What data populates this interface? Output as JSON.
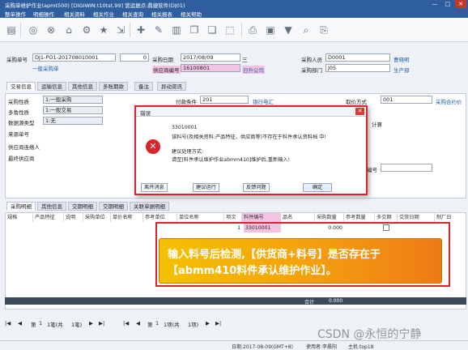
{
  "window": {
    "title": "采购单维护作业(apmt500)    [DIGIWIN:t10tst,99]    营运据点:鼎捷软件(DJ01)",
    "controls": [
      "—",
      "□",
      "✕"
    ]
  },
  "menu": [
    "整单操作",
    "明细操作",
    "相关资料",
    "相关作业",
    "相关查询",
    "相关报表",
    "相关帮助"
  ],
  "toolbar": {
    "icons": [
      "document-icon",
      "check-icon",
      "cancel-icon",
      "home-icon",
      "gear-icon",
      "bulb-icon",
      "star-icon",
      "export-icon",
      "add-icon",
      "edit-icon",
      "delete-icon",
      "copy-icon",
      "copy-icon",
      "attach-icon",
      "filter-icon",
      "search-icon",
      "clip-icon"
    ]
  },
  "header": {
    "po_no_label": "采购单号",
    "po_no_value": "DJ1-PO1-201708010001",
    "seq_value": "0",
    "po_date_label": "采购日期",
    "po_date_value": "2017/08/09",
    "po_date_weekday": "三",
    "supplier_label": "供应商编号",
    "supplier_value": "16100801",
    "supplier_name": "日升公司",
    "general_order_link": "一般采购单",
    "buyer_label": "采购人员",
    "buyer_value": "D0001",
    "buyer_name": "曹晓明",
    "dept_label": "采购部门",
    "dept_value": "J05",
    "dept_name": "生产部"
  },
  "tabs_top": [
    "交易信息",
    "运输信息",
    "其他信息",
    "多账期款",
    "备注",
    "异动资讯"
  ],
  "form": {
    "purchase_nature_label": "采购性质",
    "purchase_nature_value": "1:一般采购",
    "multi_role_label": "多角性质",
    "multi_role_value": "1:一般交易",
    "data_source_label": "数据源类型",
    "data_source_value": "1:无",
    "source_no_label": "来源单号",
    "supplier_contact_label": "供应商连络人",
    "final_supplier_label": "最终供应商",
    "payment_label": "付款条件",
    "payment_value": "201",
    "payment_name": "银行电汇",
    "price_method_label": "取价方式",
    "price_method_value": "001",
    "price_method_name": "采购合约价",
    "price_calc_label": "计算",
    "no_label": "编号"
  },
  "dialog": {
    "title": "错误",
    "code": "33010001",
    "message": "该料号(及相关资料:产品特征、供应商等)不存在于料件承认资料档 中!",
    "suggestion_title": "建议处理方式:",
    "suggestion_text": "请至[料件承认维护作业abmm410]维护后,重新输入!",
    "buttons": [
      "离开消息",
      "建议运行",
      "反馈问题",
      "确定"
    ]
  },
  "tabs_bottom": [
    "采购明细",
    "其他信息",
    "交期明细",
    "交期明细",
    "关联单据明细"
  ],
  "grid": {
    "columns": [
      "规格",
      "产品特征",
      "说明",
      "采购单位",
      "单价名称",
      "参考单位",
      "单位名称",
      "项次",
      "料件编号",
      "品名",
      "采购数量",
      "参考数量",
      "多交期",
      "交货日期",
      "制厂日"
    ],
    "row": {
      "seq": "1",
      "item_no": "33010001",
      "qty": "0.000",
      "checked": false
    },
    "total_label": "合计",
    "total_value": "0.000"
  },
  "callout": {
    "line1": "输入料号后检测,【供货商+料号】是否存在于",
    "line2": "【abmm410料件承认维护作业】。"
  },
  "pager": {
    "first": "第",
    "page": "1",
    "total_pages": "1笔(共",
    "total_pages_end": "1笔)",
    "row_label": "第",
    "row_page": "1",
    "row_total": "1项(共",
    "row_total_end": "1项)"
  },
  "status": {
    "date": "日期:2017-08-09(GMT+8)",
    "user": "使用者:李晨阳",
    "host": "主机:top18"
  },
  "watermark": "CSDN @永恒的宁静"
}
